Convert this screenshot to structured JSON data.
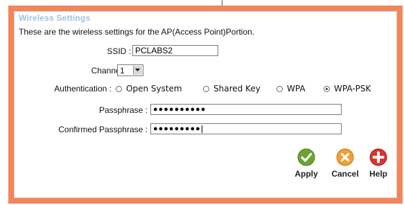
{
  "section": {
    "title": "Wireless Settings",
    "description": "These are the wireless settings for the AP(Access Point)Portion."
  },
  "fields": {
    "ssid_label": "SSID :",
    "ssid_value": "PCLABS2",
    "channel_label": "Channel :",
    "channel_value": "1",
    "auth_label": "Authentication :",
    "passphrase_label": "Passphrase :",
    "passphrase_value": "●●●●●●●●●●",
    "confirm_label": "Confirmed Passphrase :",
    "confirm_value": "●●●●●●●●●"
  },
  "auth_options": [
    {
      "label": "Open System",
      "selected": false
    },
    {
      "label": "Shared Key",
      "selected": false
    },
    {
      "label": "WPA",
      "selected": false
    },
    {
      "label": "WPA-PSK",
      "selected": true
    }
  ],
  "actions": {
    "apply": "Apply",
    "cancel": "Cancel",
    "help": "Help"
  },
  "colors": {
    "frame": "#f2855a",
    "title": "#9fc1e0",
    "apply": "#6aa532",
    "cancel": "#f0a032",
    "help": "#d8332e"
  }
}
